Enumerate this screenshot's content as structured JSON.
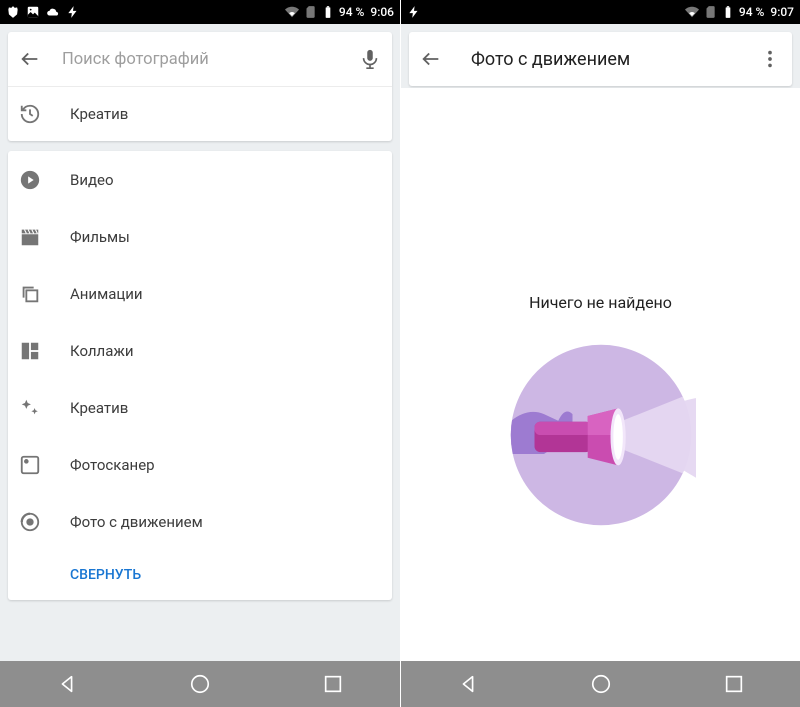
{
  "left": {
    "status": {
      "battery": "94 %",
      "time": "9:06"
    },
    "search": {
      "placeholder": "Поиск фотографий"
    },
    "recent": {
      "label": "Креатив"
    },
    "categories": [
      {
        "icon": "play",
        "label": "Видео"
      },
      {
        "icon": "clap",
        "label": "Фильмы"
      },
      {
        "icon": "frames",
        "label": "Анимации"
      },
      {
        "icon": "collage",
        "label": "Коллажи"
      },
      {
        "icon": "sparkle",
        "label": "Креатив"
      },
      {
        "icon": "scanner",
        "label": "Фотосканер"
      },
      {
        "icon": "motion",
        "label": "Фото с движением"
      }
    ],
    "collapse": "СВЕРНУТЬ"
  },
  "right": {
    "status": {
      "battery": "94 %",
      "time": "9:07"
    },
    "header": {
      "title": "Фото с движением"
    },
    "empty": "Ничего не найдено"
  }
}
